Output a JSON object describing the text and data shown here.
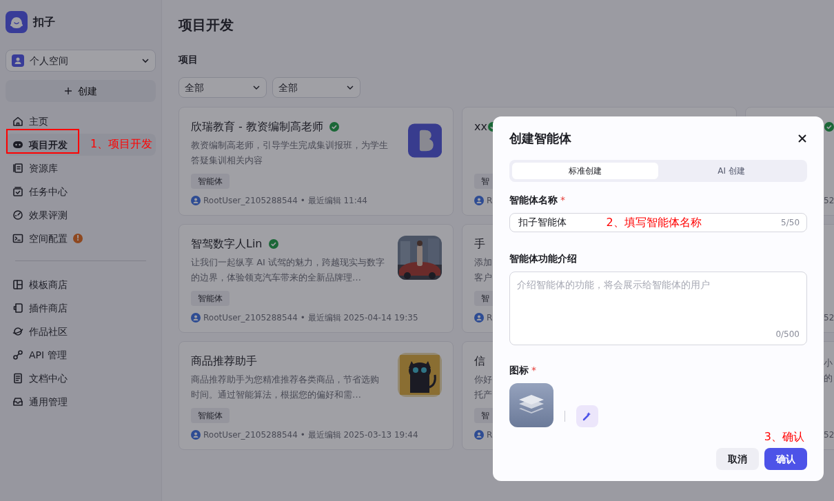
{
  "app": {
    "name": "扣子"
  },
  "workspace": {
    "label": "个人空间"
  },
  "create_button": {
    "label": "创建"
  },
  "nav": [
    {
      "label": "主页",
      "selected": false
    },
    {
      "label": "项目开发",
      "selected": true
    },
    {
      "label": "资源库",
      "selected": false
    },
    {
      "label": "任务中心",
      "selected": false
    },
    {
      "label": "效果评测",
      "selected": false
    },
    {
      "label": "空间配置",
      "selected": false,
      "badge": "!"
    }
  ],
  "nav_secondary": [
    {
      "label": "模板商店",
      "selected": false
    },
    {
      "label": "插件商店",
      "selected": false
    },
    {
      "label": "作品社区",
      "selected": false
    },
    {
      "label": "API 管理",
      "selected": false
    },
    {
      "label": "文档中心",
      "selected": false
    },
    {
      "label": "通用管理",
      "selected": false
    }
  ],
  "page": {
    "title": "项目开发",
    "section": "项目",
    "filters": [
      {
        "value": "全部"
      },
      {
        "value": "全部"
      }
    ]
  },
  "columns": [
    {
      "cards": [
        {
          "title": "欣瑞教育 - 教资编制高老师",
          "verified": true,
          "description": "教资编制高老师，引导学生完成集训报班，为学生答疑集训相关内容",
          "tag": "智能体",
          "meta": "RootUser_2105288544 • 最近编辑 11:44"
        },
        {
          "title": "智驾数字人Lin",
          "verified": true,
          "description": "让我们一起纵享 AI 试驾的魅力，跨越现实与数字的边界，体验领克汽车带来的全新品牌理…",
          "tag": "智能体",
          "meta": "RootUser_2105288544 • 最近编辑 2025-04-14 19:35"
        },
        {
          "title": "商品推荐助手",
          "verified": false,
          "description": "商品推荐助手为您精准推荐各类商品，节省选购时间。通过智能算法，根据您的偏好和需…",
          "tag": "智能体",
          "meta": "RootUser_2105288544 • 最近编辑 2025-03-13 19:44"
        }
      ]
    },
    {
      "cards": [
        {
          "title": "xx",
          "verified": true,
          "tag": "智",
          "meta": "R"
        },
        {
          "title": "手",
          "description_lines": [
            "添加",
            "客户"
          ],
          "tag": "智",
          "meta": "R"
        },
        {
          "title": "信",
          "description_lines": [
            "你好",
            "托产"
          ],
          "tag": "智",
          "meta": "R"
        }
      ]
    },
    {
      "cards": [
        {
          "verified": true,
          "meta": "52"
        },
        {
          "meta": "52"
        },
        {
          "description_lines": [
            "小",
            "的"
          ],
          "meta": "52"
        }
      ]
    }
  ],
  "dialog": {
    "title": "创建智能体",
    "tabs": [
      {
        "label": "标准创建",
        "selected": true
      },
      {
        "label": "AI 创建",
        "selected": false
      }
    ],
    "name_field": {
      "label": "智能体名称",
      "required_mark": "*",
      "value": "扣子智能体",
      "counter": "5/50"
    },
    "description_field": {
      "label": "智能体功能介绍",
      "placeholder": "介绍智能体的功能，将会展示给智能体的用户",
      "counter": "0/500"
    },
    "icon_field": {
      "label": "图标",
      "required_mark": "*"
    },
    "buttons": [
      {
        "label": "取消",
        "kind": "secondary"
      },
      {
        "label": "确认",
        "kind": "primary"
      }
    ]
  },
  "annotations": [
    {
      "text": "1、项目开发",
      "boxed": true
    },
    {
      "text": "2、填写智能体名称"
    },
    {
      "text": "3、确认"
    }
  ]
}
